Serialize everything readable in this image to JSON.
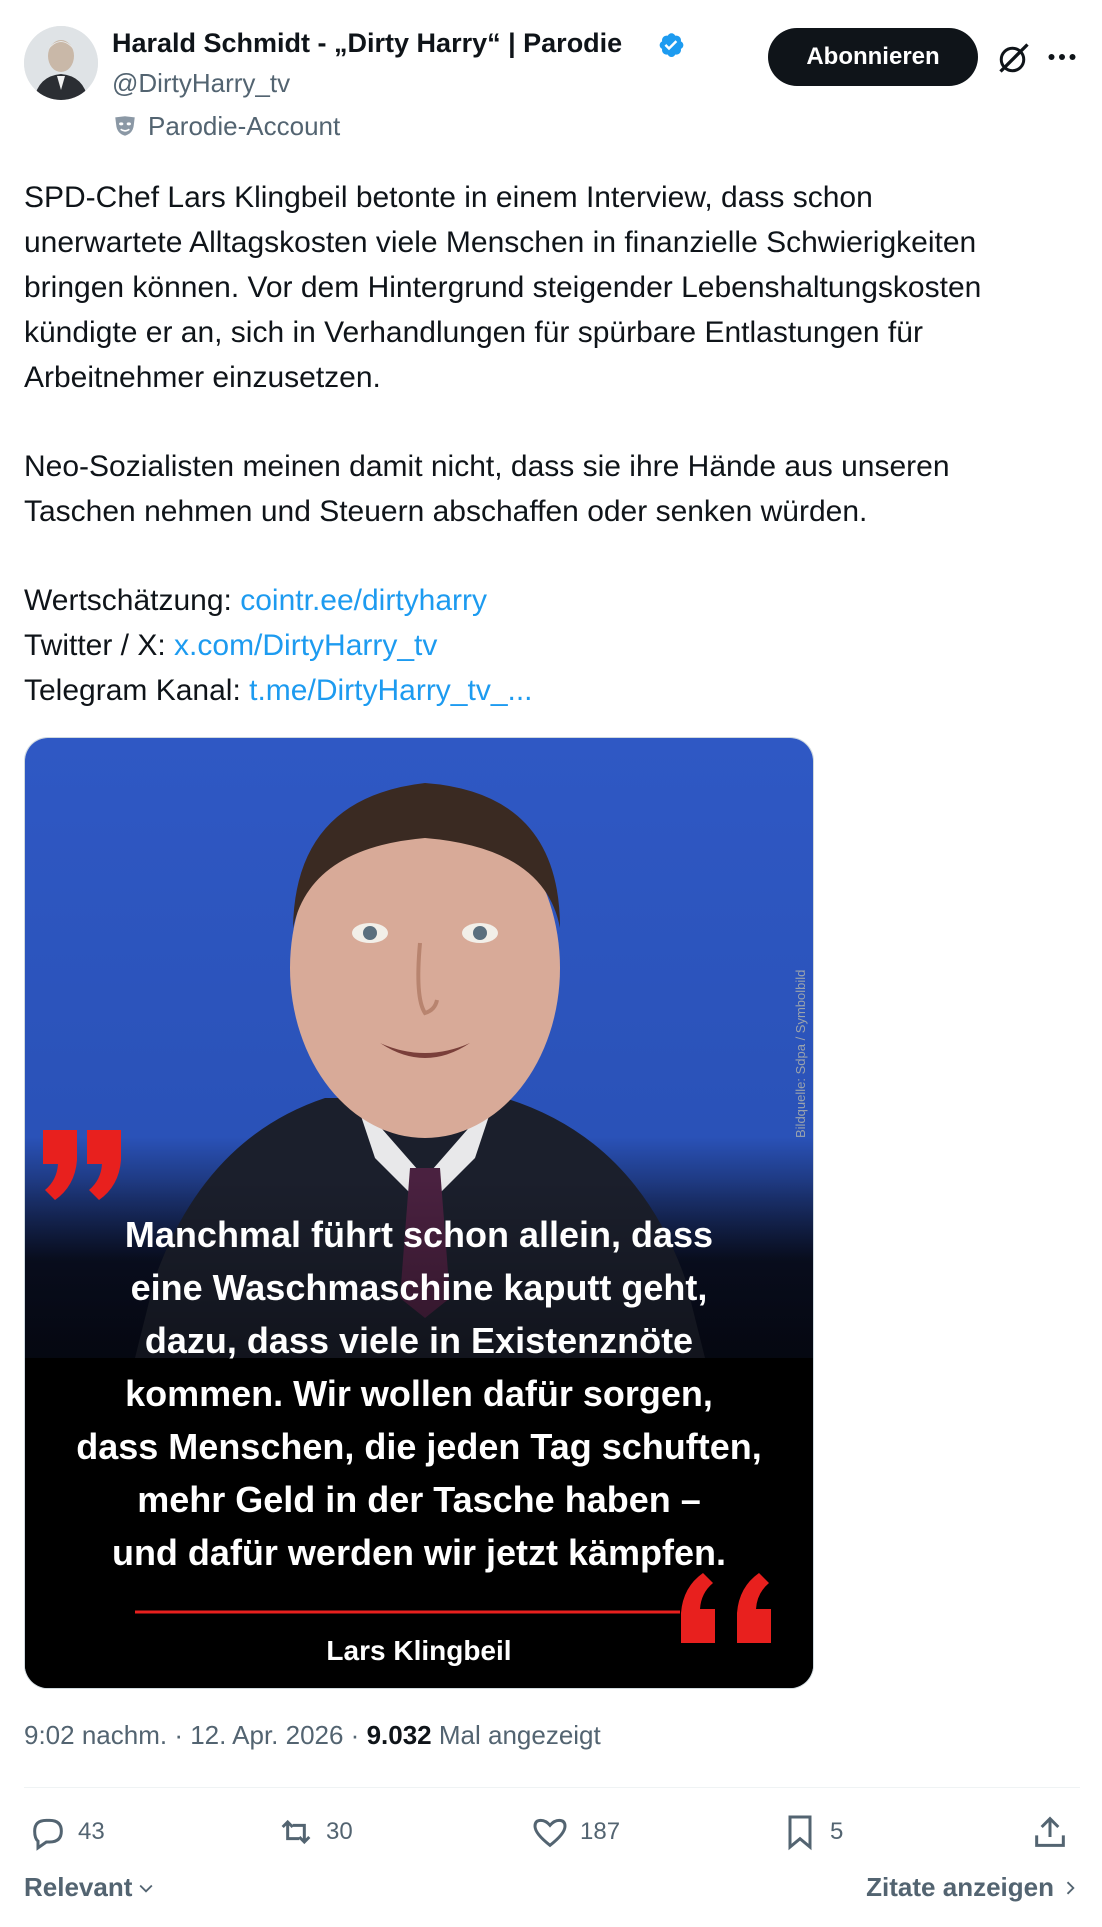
{
  "author": {
    "display_name": "Harald Schmidt - „Dirty Harry“ | Parodie",
    "handle": "@DirtyHarry_tv",
    "parody_label": "Parodie-Account"
  },
  "header": {
    "follow_label": "Abonnieren"
  },
  "tweet": {
    "lines": [
      "SPD-Chef  Lars Klingbeil betonte in einem Interview, dass schon",
      "unerwartete  Alltagskosten viele Menschen in finanzielle Schwierigkeiten",
      "bringen  können. Vor dem Hintergrund steigender Lebenshaltungskosten",
      "kündigte er  an, sich in Verhandlungen für spürbare Entlastungen für",
      "Arbeitnehmer einzusetzen.",
      "Neo-Sozialisten meinen damit nicht, dass sie ihre Hände aus unseren",
      "Taschen nehmen und Steuern abschaffen oder senken würden."
    ],
    "links": [
      {
        "label": "Wertschätzung:",
        "url_text": "cointr.ee/dirtyharry"
      },
      {
        "label": "Twitter / X:",
        "url_text": "x.com/DirtyHarry_tv"
      },
      {
        "label": "Telegram Kanal:",
        "url_text": "t.me/DirtyHarry_tv_..."
      }
    ]
  },
  "media": {
    "quote_lines": [
      "Manchmal führt schon allein, dass",
      "eine Waschmaschine kaputt geht,",
      "dazu, dass viele in Existenznöte",
      "kommen. Wir wollen dafür sorgen,",
      "dass Menschen, die jeden Tag schuften,",
      "mehr Geld in der Tasche haben –",
      "und dafür werden wir jetzt kämpfen."
    ],
    "quote_author": "Lars Klingbeil",
    "credit": "Bildquelle: Sdpa / Symbolbild"
  },
  "meta": {
    "time": "9:02 nachm.",
    "sep1": " · ",
    "date": "12. Apr. 2026",
    "sep2": " · ",
    "views": "9.032",
    "views_label": " Mal angezeigt"
  },
  "actions": {
    "replies": "43",
    "reposts": "30",
    "likes": "187",
    "bookmarks": "5"
  },
  "footer": {
    "sort_label": "Relevant",
    "quotes_label": "Zitate anzeigen"
  },
  "colors": {
    "link": "#1d9bf0",
    "verified": "#1d9bf0",
    "quote_mark": "#e8201e",
    "image_bg_top": "#2f58c4",
    "image_bg_bottom": "#000000"
  }
}
